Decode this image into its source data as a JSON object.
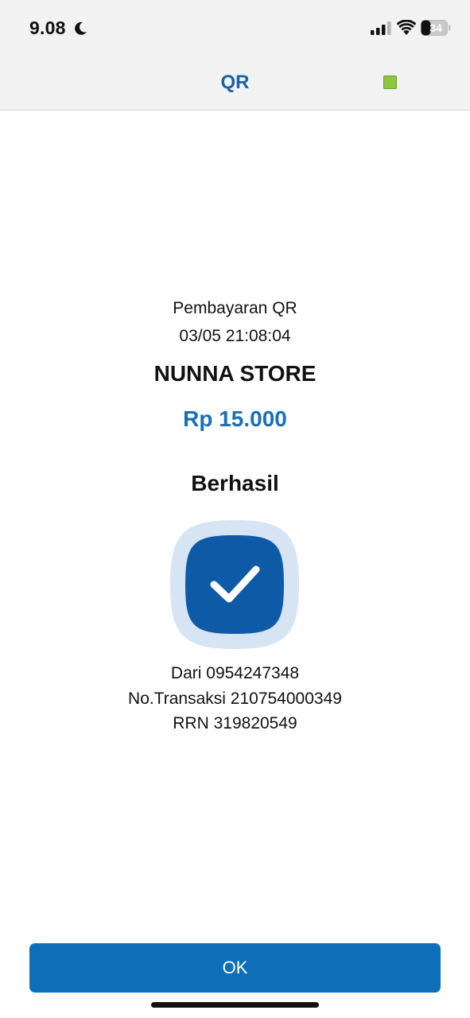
{
  "status_bar": {
    "time": "9.08",
    "battery": "34"
  },
  "header": {
    "title": "QR"
  },
  "receipt": {
    "payment_type": "Pembayaran QR",
    "datetime": "03/05 21:08:04",
    "merchant": "NUNNA STORE",
    "amount": "Rp 15.000",
    "status": "Berhasil",
    "from": "Dari 0954247348",
    "transaction_no": "No.Transaksi 210754000349",
    "rrn": "RRN 319820549"
  },
  "actions": {
    "ok_label": "OK"
  },
  "colors": {
    "accent": "#1770b8",
    "button": "#0d6fb8",
    "check_inner": "#0e5aa7",
    "check_outer": "#d6e4f3",
    "indicator": "#8cc63f"
  },
  "icons": {
    "moon": "moon-icon",
    "signal": "signal-icon",
    "wifi": "wifi-icon",
    "battery": "battery-icon",
    "success": "checkmark-icon"
  }
}
